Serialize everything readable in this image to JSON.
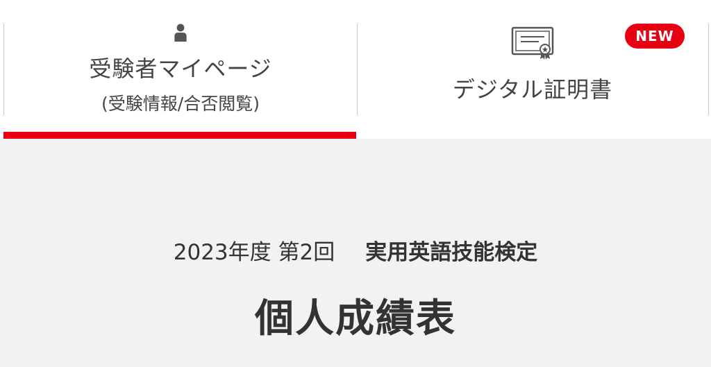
{
  "nav": {
    "tabs": [
      {
        "label": "受験者マイページ",
        "sub_label": "(受験情報/合否閲覧)",
        "icon": "person-icon",
        "active": true
      },
      {
        "label": "デジタル証明書",
        "icon": "certificate-icon",
        "active": false
      }
    ],
    "new_badge": "NEW",
    "accent_color": "#e60012"
  },
  "main": {
    "exam_period": "2023年度 第2回",
    "exam_name": "実用英語技能検定",
    "title": "個人成績表"
  }
}
